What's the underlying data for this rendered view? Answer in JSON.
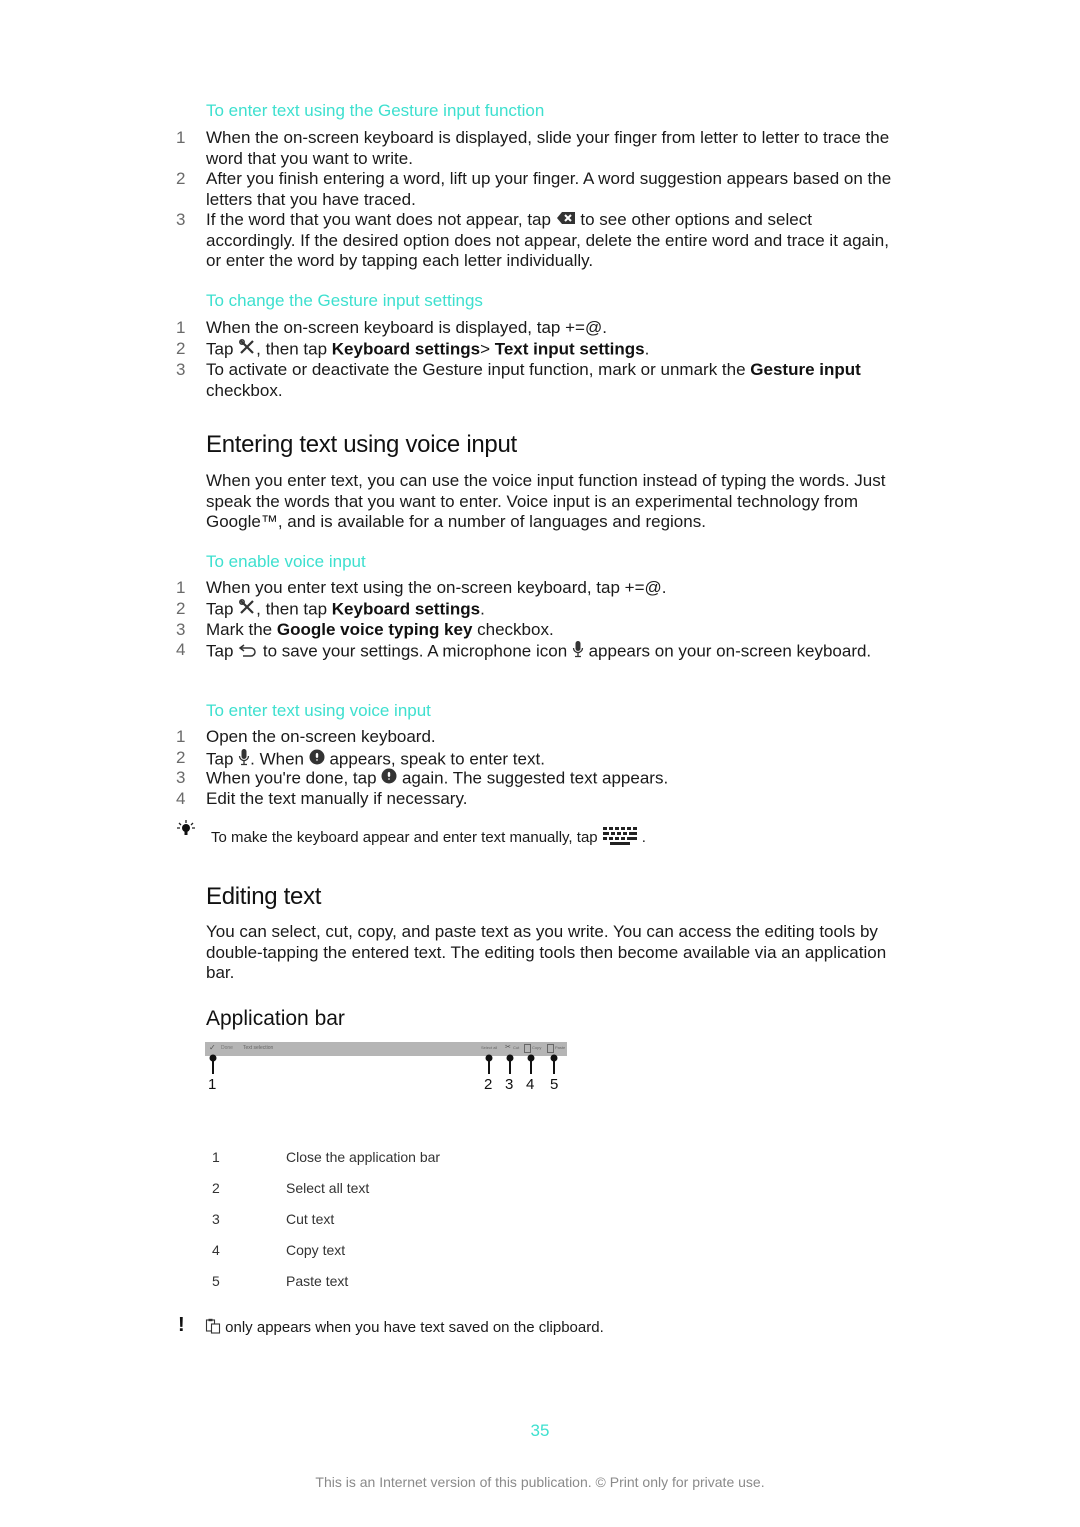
{
  "sections": {
    "gesture_enter": {
      "title": "To enter text using the Gesture input function",
      "steps": [
        {
          "n": "1",
          "text": "When the on-screen keyboard is displayed, slide your finger from letter to letter to trace the word that you want to write."
        },
        {
          "n": "2",
          "text": "After you finish entering a word, lift up your finger. A word suggestion appears based on the letters that you have traced."
        },
        {
          "n": "3",
          "pre": "If the word that you want does not appear, tap ",
          "icon": "backspace-icon",
          "post": " to see other options and select accordingly. If the desired option does not appear, delete the entire word and trace it again, or enter the word by tapping each letter individually."
        }
      ]
    },
    "gesture_settings": {
      "title": "To change the Gesture input settings",
      "steps": [
        {
          "n": "1",
          "pre": "When the on-screen keyboard is displayed, tap ",
          "key": "+=@",
          "post": "."
        },
        {
          "n": "2",
          "pre": "Tap ",
          "icon": "tools-icon",
          "mid": ", then tap ",
          "bold1": "Keyboard settings",
          "sep": "> ",
          "bold2": "Text input settings",
          "post": "."
        },
        {
          "n": "3",
          "pre": "To activate or deactivate the Gesture input function, mark or unmark the ",
          "bold1": "Gesture input",
          "post": " checkbox."
        }
      ]
    },
    "voice": {
      "heading": "Entering text using voice input",
      "intro": "When you enter text, you can use the voice input function instead of typing the words. Just speak the words that you want to enter. Voice input is an experimental technology from Google™, and is available for a number of languages and regions."
    },
    "voice_enable": {
      "title": "To enable voice input",
      "steps": [
        {
          "n": "1",
          "pre": "When you enter text using the on-screen keyboard, tap ",
          "key": "+=@",
          "post": "."
        },
        {
          "n": "2",
          "pre": "Tap ",
          "icon": "tools-icon",
          "mid": ", then tap ",
          "bold1": "Keyboard settings",
          "post": "."
        },
        {
          "n": "3",
          "pre": "Mark the ",
          "bold1": "Google voice typing key",
          "post": " checkbox."
        },
        {
          "n": "4",
          "pre": "Tap ",
          "icon": "back-icon",
          "mid": " to save your settings. A microphone icon ",
          "icon2": "microphone-icon",
          "post": " appears on your on-screen keyboard."
        }
      ]
    },
    "voice_enter": {
      "title": "To enter text using voice input",
      "steps": [
        {
          "n": "1",
          "text": "Open the on-screen keyboard."
        },
        {
          "n": "2",
          "pre": "Tap ",
          "icon": "microphone-icon",
          "mid": ". When ",
          "icon2": "record-icon",
          "post": " appears, speak to enter text."
        },
        {
          "n": "3",
          "pre": "When you're done, tap ",
          "icon": "record-icon",
          "post": " again. The suggested text appears."
        },
        {
          "n": "4",
          "text": "Edit the text manually if necessary."
        }
      ],
      "tip": {
        "pre": "To make the keyboard appear and enter text manually, tap ",
        "icon": "keyboard-icon",
        "post": "."
      }
    },
    "editing": {
      "heading": "Editing text",
      "intro": "You can select, cut, copy, and paste text as you write. You can access the editing tools by double-tapping the entered text. The editing tools then become available via an application bar.",
      "subheading": "Application bar",
      "appbar": {
        "left": [
          "Done",
          "Text selection"
        ],
        "right": [
          "Select all",
          "Cut",
          "Copy",
          "Paste"
        ],
        "callouts": [
          "1",
          "2",
          "3",
          "4",
          "5"
        ]
      },
      "legend": [
        {
          "n": "1",
          "text": "Close the application bar"
        },
        {
          "n": "2",
          "text": "Select all text"
        },
        {
          "n": "3",
          "text": "Cut text"
        },
        {
          "n": "4",
          "text": "Copy text"
        },
        {
          "n": "5",
          "text": "Paste text"
        }
      ],
      "note": {
        "icon": "paste-icon",
        "text": " only appears when you have text saved on the clipboard."
      }
    }
  },
  "footer": {
    "page_number": "35",
    "notice": "This is an Internet version of this publication. © Print only for private use."
  },
  "colors": {
    "accent": "#3ee0cf",
    "text": "#1a1a1a"
  }
}
